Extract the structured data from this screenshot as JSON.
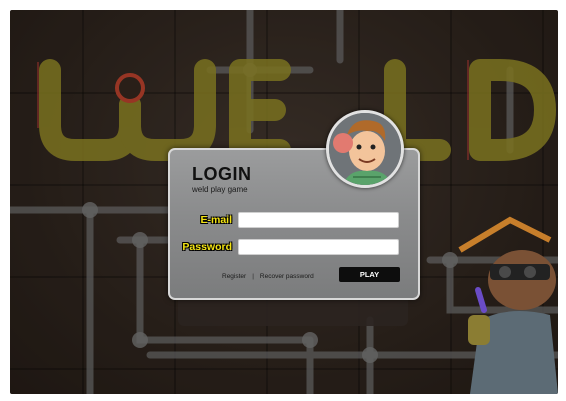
{
  "logo": {
    "text": "WELD"
  },
  "login": {
    "title": "LOGIN",
    "subtitle": "weld play game",
    "email_label": "E-mail",
    "password_label": "Password",
    "email_value": "",
    "password_value": "",
    "register_link": "Register",
    "separator": "|",
    "recover_link": "Recover password",
    "play_button": "PLAY"
  },
  "colors": {
    "label_yellow": "#f3e312",
    "logo_olive": "#8a8423",
    "panel_gray": "#8a8b8c",
    "button_black": "#0d0d0d"
  },
  "icons": {
    "avatar": "smiling-welder-avatar-icon",
    "character": "welder-with-torch-icon"
  }
}
